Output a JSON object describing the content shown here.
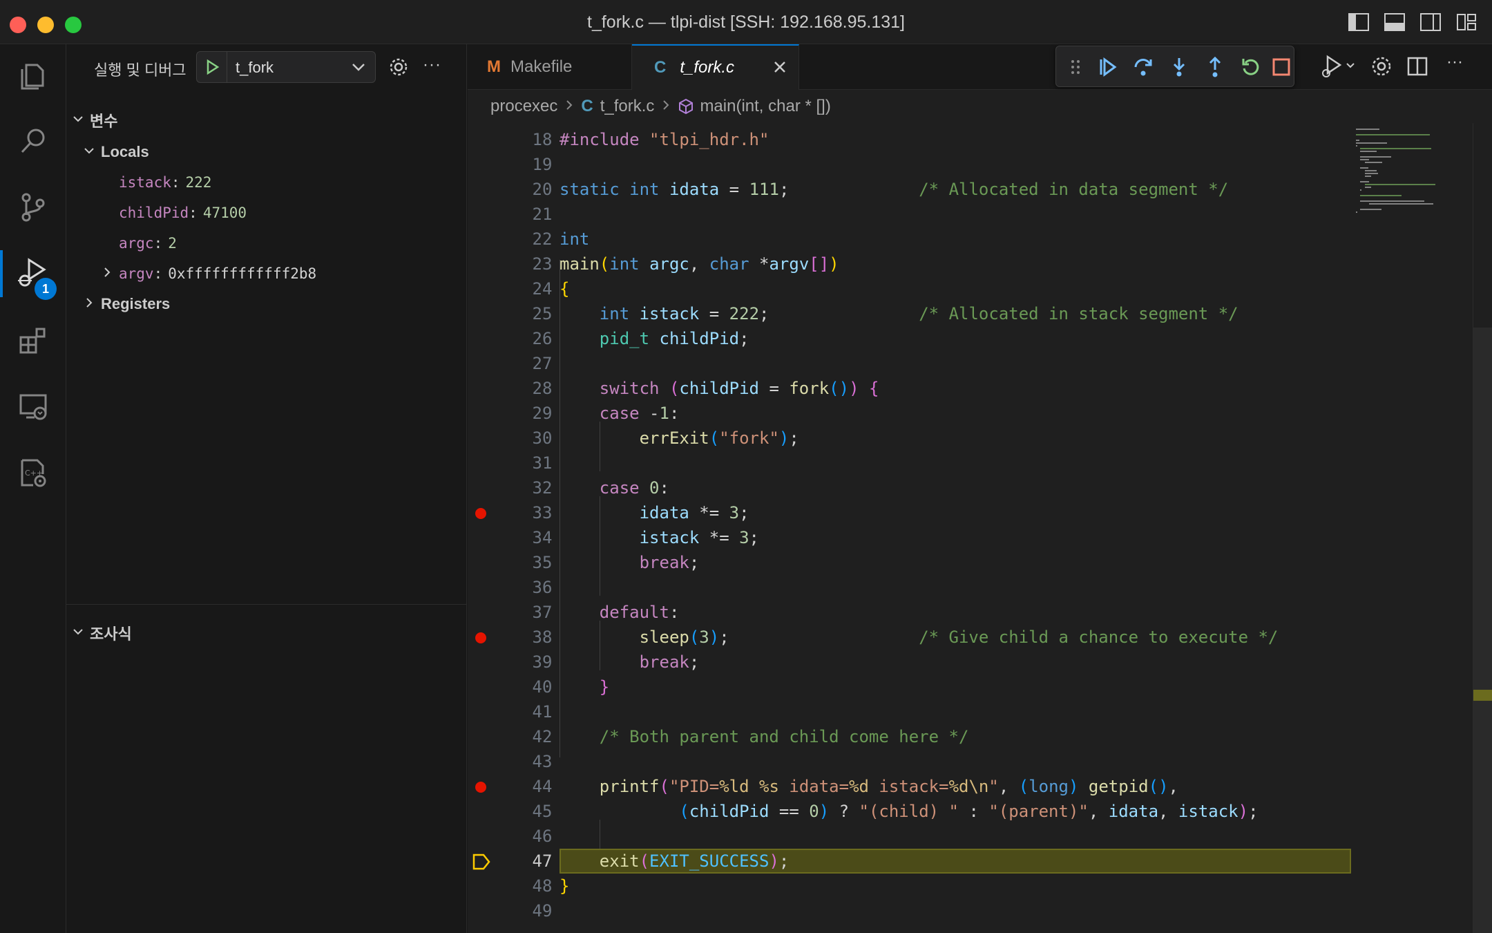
{
  "window": {
    "title": "t_fork.c — tlpi-dist [SSH: 192.168.95.131]"
  },
  "activity_bar": {
    "items": [
      {
        "name": "explorer-icon"
      },
      {
        "name": "search-icon"
      },
      {
        "name": "source-control-icon"
      },
      {
        "name": "run-debug-icon",
        "badge": "1",
        "active": true
      },
      {
        "name": "extensions-icon"
      },
      {
        "name": "remote-explorer-icon"
      },
      {
        "name": "cmake-icon"
      }
    ]
  },
  "sidebar": {
    "title": "실행 및 디버그",
    "config_name": "t_fork",
    "variables_header": "변수",
    "locals_label": "Locals",
    "locals": [
      {
        "name": "istack",
        "value": "222"
      },
      {
        "name": "childPid",
        "value": "47100"
      },
      {
        "name": "argc",
        "value": "2"
      },
      {
        "name": "argv",
        "value": "0xffffffffffff2b8"
      }
    ],
    "registers_label": "Registers",
    "watch_header": "조사식"
  },
  "tabs": [
    {
      "label": "Makefile",
      "icon": "M"
    },
    {
      "label": "t_fork.c",
      "icon": "C",
      "active": true
    }
  ],
  "breadcrumb": {
    "folder": "procexec",
    "file_icon": "C",
    "file": "t_fork.c",
    "symbol": "main(int, char * [])"
  },
  "editor": {
    "current_line": 47,
    "breakpoints": [
      33,
      38,
      44
    ],
    "lines": [
      {
        "n": "18",
        "text": "#include \"tlpi_hdr.h\""
      },
      {
        "n": "19",
        "text": ""
      },
      {
        "n": "20",
        "text": "static int idata = 111;             /* Allocated in data segment */"
      },
      {
        "n": "21",
        "text": ""
      },
      {
        "n": "22",
        "text": "int"
      },
      {
        "n": "23",
        "text": "main(int argc, char *argv[])"
      },
      {
        "n": "24",
        "text": "{"
      },
      {
        "n": "25",
        "text": "    int istack = 222;               /* Allocated in stack segment */"
      },
      {
        "n": "26",
        "text": "    pid_t childPid;"
      },
      {
        "n": "27",
        "text": ""
      },
      {
        "n": "28",
        "text": "    switch (childPid = fork()) {"
      },
      {
        "n": "29",
        "text": "    case -1:"
      },
      {
        "n": "30",
        "text": "        errExit(\"fork\");"
      },
      {
        "n": "31",
        "text": ""
      },
      {
        "n": "32",
        "text": "    case 0:"
      },
      {
        "n": "33",
        "text": "        idata *= 3;"
      },
      {
        "n": "34",
        "text": "        istack *= 3;"
      },
      {
        "n": "35",
        "text": "        break;"
      },
      {
        "n": "36",
        "text": ""
      },
      {
        "n": "37",
        "text": "    default:"
      },
      {
        "n": "38",
        "text": "        sleep(3);                   /* Give child a chance to execute */"
      },
      {
        "n": "39",
        "text": "        break;"
      },
      {
        "n": "40",
        "text": "    }"
      },
      {
        "n": "41",
        "text": ""
      },
      {
        "n": "42",
        "text": "    /* Both parent and child come here */"
      },
      {
        "n": "43",
        "text": ""
      },
      {
        "n": "44",
        "text": "    printf(\"PID=%ld %s idata=%d istack=%d\\n\", (long) getpid(),"
      },
      {
        "n": "45",
        "text": "            (childPid == 0) ? \"(child) \" : \"(parent)\", idata, istack);"
      },
      {
        "n": "46",
        "text": ""
      },
      {
        "n": "47",
        "text": "    exit(EXIT_SUCCESS);"
      },
      {
        "n": "48",
        "text": "}"
      },
      {
        "n": "49",
        "text": ""
      }
    ]
  },
  "colors": {
    "accent": "#0078d4",
    "breakpoint": "#e51400",
    "current_line_bg": "#4b4b18",
    "continue": "#75beff",
    "restart": "#89d185",
    "stop": "#f48771"
  }
}
